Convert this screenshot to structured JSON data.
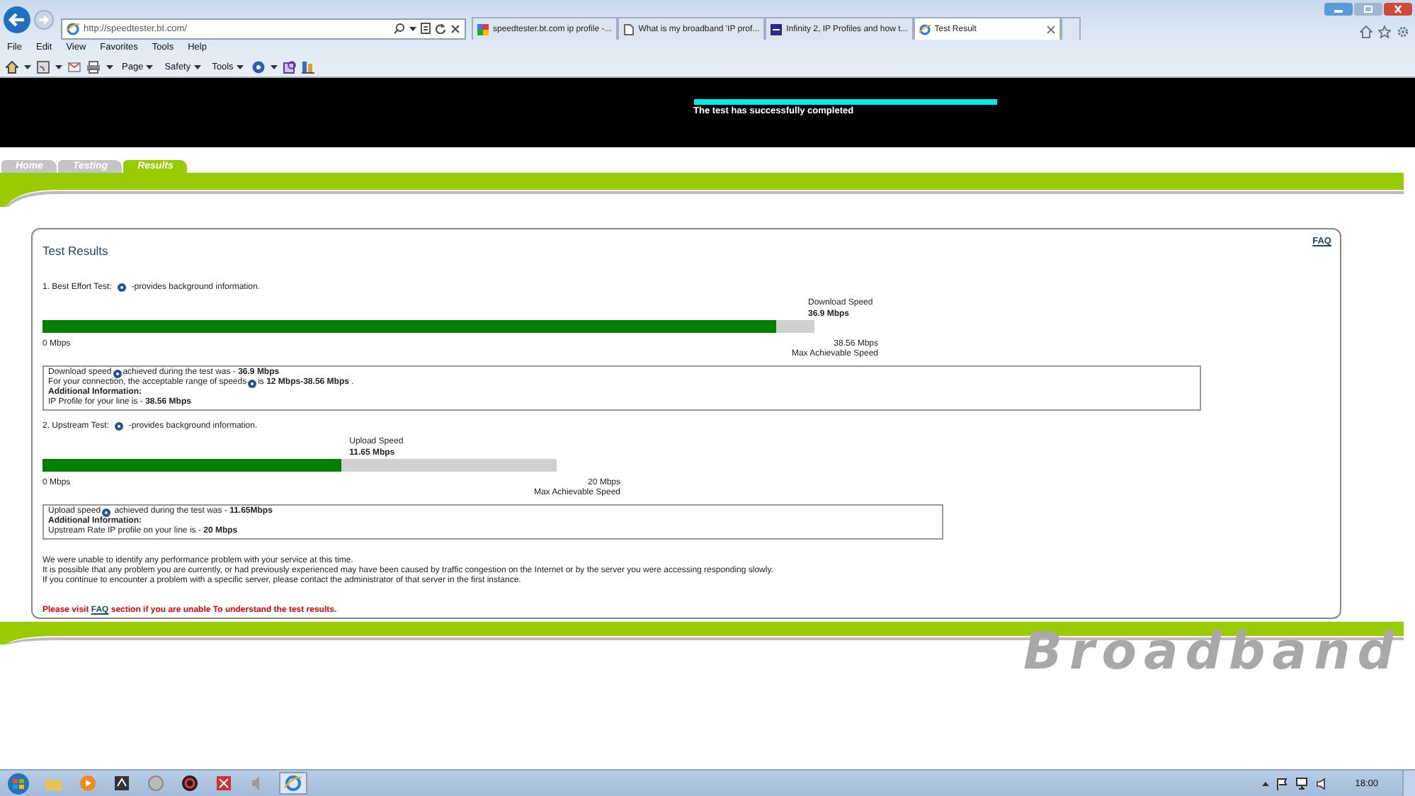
{
  "browser": {
    "address": "http://speedtester.bt.com/",
    "tabs": [
      {
        "title": "speedtester.bt.com ip profile -...",
        "selected": false
      },
      {
        "title": "What is my broadband 'IP prof...",
        "selected": false
      },
      {
        "title": "Infinity 2, IP Profiles and how t...",
        "selected": false
      },
      {
        "title": "Test Result",
        "selected": true
      }
    ],
    "menu": [
      "File",
      "Edit",
      "View",
      "Favorites",
      "Tools",
      "Help"
    ],
    "toolbar": [
      "Page",
      "Safety",
      "Tools"
    ]
  },
  "header": {
    "progress": {
      "level": 1
    },
    "message": "The test has successfully completed"
  },
  "nav_tabs": [
    {
      "label": "Home",
      "selected": false
    },
    {
      "label": "Testing",
      "selected": false
    },
    {
      "label": "Results",
      "selected": true
    }
  ],
  "results": {
    "title": "Test Results",
    "faq": "FAQ",
    "sections": [
      {
        "heading": "1. Best Effort Test:",
        "heading_note": "-provides background information.",
        "gauge": {
          "label": "Download Speed",
          "value": "36.9 Mbps",
          "level": 0.95,
          "min": "0 Mbps",
          "max": "38.56 Mbps",
          "max_label": "Max Achievable Speed"
        },
        "info": [
          [
            {
              "kind": "text",
              "text": "Download speed"
            },
            {
              "kind": "help"
            },
            {
              "kind": "text",
              "text": "achieved during the test was - **36.9 Mbps**"
            }
          ],
          [
            {
              "kind": "text",
              "text": "For your connection, the acceptable range of speeds"
            },
            {
              "kind": "help"
            },
            {
              "kind": "text",
              "text": "is **12 Mbps-38.56 Mbps** ."
            }
          ],
          [
            {
              "kind": "bold",
              "text": "Additional Information:"
            }
          ],
          [
            {
              "kind": "text",
              "text": "IP Profile for your line is - **38.56 Mbps**"
            }
          ]
        ]
      },
      {
        "heading": "2. Upstream Test:",
        "heading_note": "-provides background information.",
        "gauge": {
          "label": "Upload Speed",
          "value": "11.65 Mbps",
          "level": 0.58,
          "min": "0 Mbps",
          "max": "20 Mbps",
          "max_label": "Max Achievable Speed"
        },
        "info": [
          [
            {
              "kind": "text",
              "text": "Upload speed"
            },
            {
              "kind": "help"
            },
            {
              "kind": "text",
              "text": " achieved during the test was - **11.65Mbps**"
            }
          ],
          [
            {
              "kind": "bold",
              "text": "Additional Information:"
            }
          ],
          [
            {
              "kind": "text",
              "text": "Upstream Rate IP profile on your line is - **20 Mbps**"
            }
          ]
        ]
      }
    ],
    "notes": [
      "We were unable to identify any performance problem with your service at this time.",
      "It is possible that any problem you are currently, or had previously experienced may have been caused by traffic congestion on the Internet or by the server you were accessing responding slowly.",
      "If you continue to encounter a problem with a specific server, please contact the administrator of that server in the first instance."
    ],
    "help_line": {
      "before": "Please visit ",
      "link": "FAQ",
      "after": " section if you are unable To understand the test results."
    }
  },
  "footer": {
    "brand": "Broadband"
  },
  "taskbar": {
    "time": "18:00"
  }
}
